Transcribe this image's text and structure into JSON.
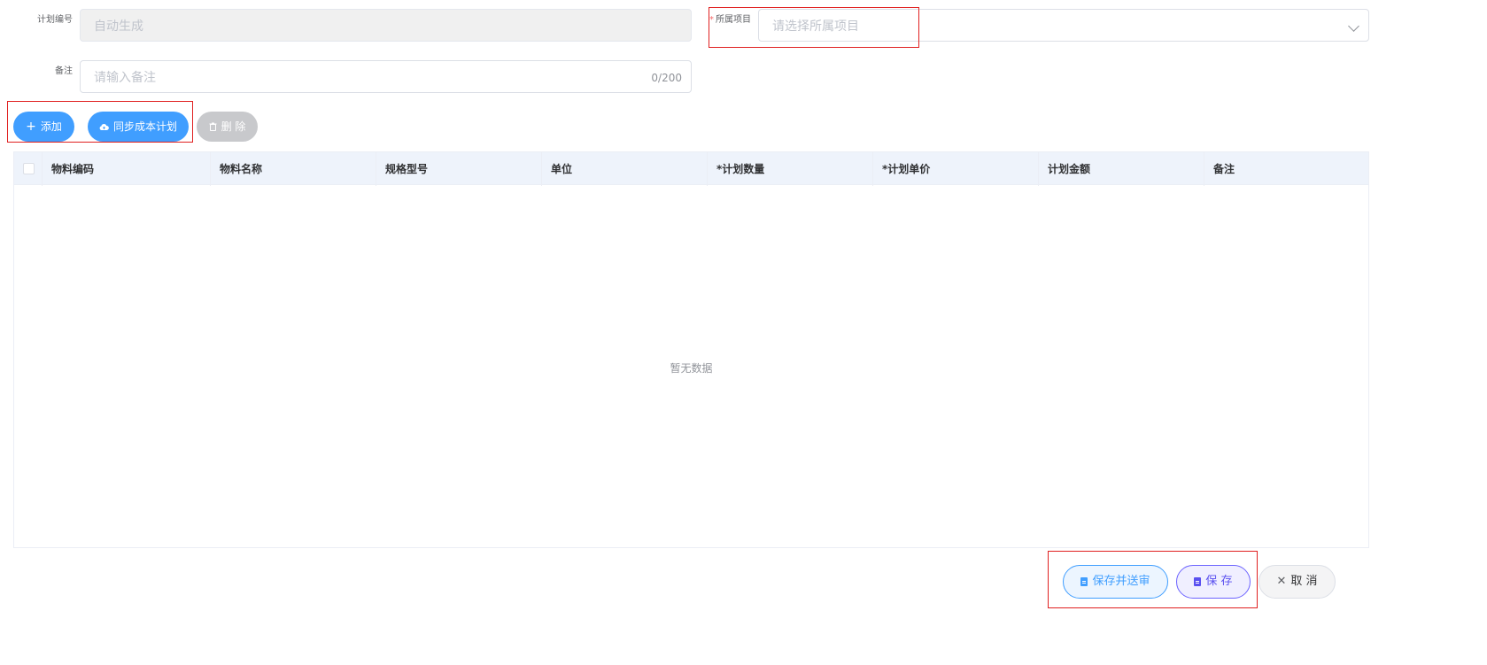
{
  "form": {
    "plan_no_label": "计划编号",
    "plan_no_value": "自动生成",
    "project_label": "所属项目",
    "project_required": "*",
    "project_placeholder": "请选择所属项目",
    "remark_label": "备注",
    "remark_placeholder": "请输入备注",
    "remark_counter": "0/200"
  },
  "toolbar": {
    "add_label": "添加",
    "sync_label": "同步成本计划",
    "delete_label": "删 除"
  },
  "table": {
    "columns": [
      "物料编码",
      "物料名称",
      "规格型号",
      "单位",
      "*计划数量",
      "*计划单价",
      "计划金额",
      "备注"
    ],
    "empty_text": "暂无数据"
  },
  "footer": {
    "save_submit_label": "保存并送审",
    "save_label": "保 存",
    "cancel_label": "取 消"
  },
  "colors": {
    "accent": "#409eff",
    "highlight_box": "#e02020",
    "save_purple": "#5a50f0"
  }
}
